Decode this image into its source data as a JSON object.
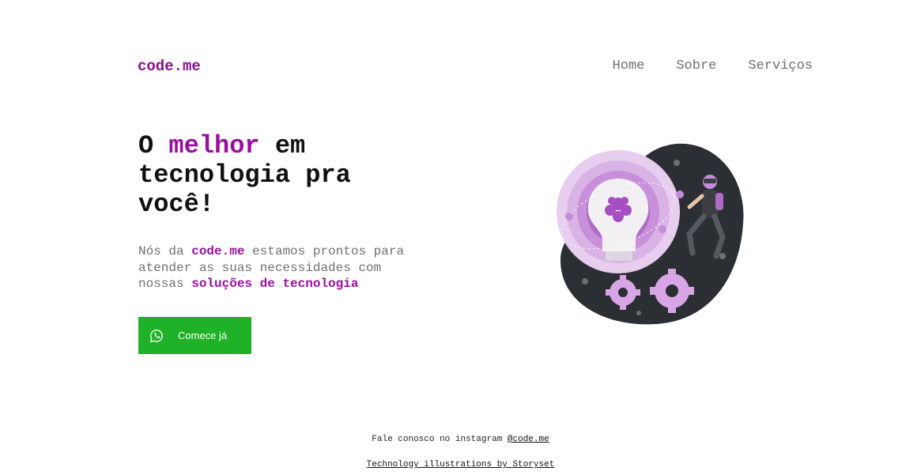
{
  "header": {
    "logo": "code.me",
    "nav": [
      "Home",
      "Sobre",
      "Serviços"
    ]
  },
  "hero": {
    "title_part1": "O ",
    "title_accent": "melhor",
    "title_part2": " em tecnologia pra você!",
    "text_part1": "Nós da ",
    "text_brand": "code.me",
    "text_part2": " estamos prontos para atender as suas necessidades com nossas ",
    "text_highlight": "soluções de tecnologia",
    "cta_label": "Comece já",
    "cta_icon": "whatsapp-icon"
  },
  "footer": {
    "line1_text": "Fale conosco no instagram ",
    "line1_link": "@code.me",
    "line2_link": "Technology illustrations by Storyset"
  },
  "colors": {
    "accent": "#9b0fa0",
    "cta": "#1fb127",
    "illustration_dark": "#2b2f33",
    "illustration_purple": "#b06bc8"
  }
}
